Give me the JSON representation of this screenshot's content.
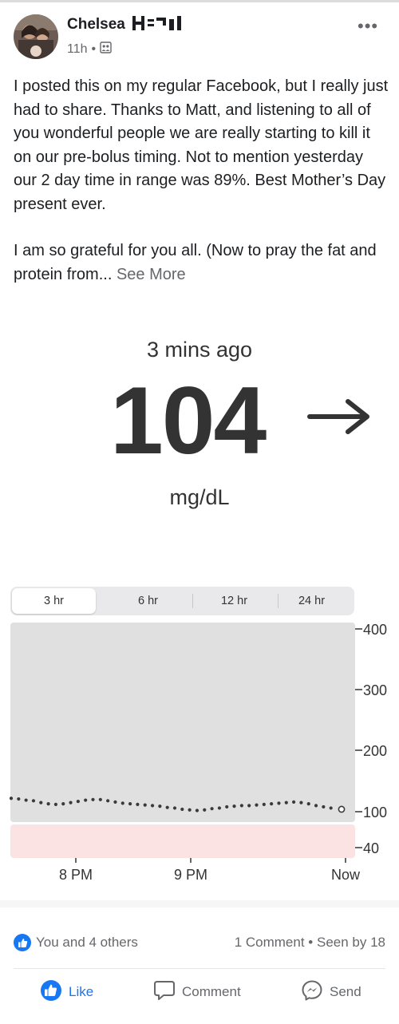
{
  "author": {
    "name": "Chelsea"
  },
  "post_meta": {
    "time": "11h",
    "separator": "•"
  },
  "post": {
    "paragraph1": "I posted this on my regular Facebook, but I really just had to share. Thanks to Matt, and listening to all of you wonderful people we are really starting to kill it on our pre-bolus timing. Not to mention yesterday our 2 day time in range was 89%. Best Mother’s Day present ever.",
    "paragraph2": "I am so grateful for you all. (Now to pray the fat and protein from...",
    "see_more": "See More"
  },
  "cgm": {
    "updated": "3 mins ago",
    "reading": "104",
    "unit": "mg/dL",
    "trend_icon": "arrow-right-icon",
    "ranges": [
      "3 hr",
      "6 hr",
      "12 hr",
      "24 hr"
    ],
    "selected_range": "3 hr"
  },
  "chart_data": {
    "type": "scatter",
    "x_tick_labels": [
      "8 PM",
      "9 PM",
      "Now"
    ],
    "y_ticks": [
      400,
      300,
      200,
      100,
      40
    ],
    "ylim": [
      40,
      400
    ],
    "target_range": [
      70,
      180
    ],
    "low_band": [
      40,
      70
    ],
    "colors": {
      "plot_bg": "#e0e0e0",
      "low_band": "#fbe3e4",
      "points": "#3a3a3a"
    },
    "series": [
      {
        "points": [
          [
            0,
            122
          ],
          [
            1,
            121
          ],
          [
            2,
            119
          ],
          [
            3,
            118
          ],
          [
            4,
            115
          ],
          [
            5,
            113
          ],
          [
            6,
            112
          ],
          [
            7,
            113
          ],
          [
            8,
            115
          ],
          [
            9,
            117
          ],
          [
            10,
            119
          ],
          [
            11,
            120
          ],
          [
            12,
            120
          ],
          [
            13,
            118
          ],
          [
            14,
            116
          ],
          [
            15,
            114
          ],
          [
            16,
            113
          ],
          [
            17,
            112
          ],
          [
            18,
            111
          ],
          [
            19,
            110
          ],
          [
            20,
            109
          ],
          [
            21,
            107
          ],
          [
            22,
            106
          ],
          [
            23,
            104
          ],
          [
            24,
            103
          ],
          [
            25,
            102
          ],
          [
            26,
            103
          ],
          [
            27,
            105
          ],
          [
            28,
            106
          ],
          [
            29,
            108
          ],
          [
            30,
            109
          ],
          [
            31,
            110
          ],
          [
            32,
            110
          ],
          [
            33,
            111
          ],
          [
            34,
            112
          ],
          [
            35,
            113
          ],
          [
            36,
            114
          ],
          [
            37,
            115
          ],
          [
            38,
            116
          ],
          [
            39,
            115
          ],
          [
            40,
            113
          ],
          [
            41,
            110
          ],
          [
            42,
            108
          ],
          [
            43,
            106
          ],
          [
            44,
            104
          ]
        ]
      }
    ]
  },
  "engagement": {
    "reactions": "You and 4 others",
    "comments": "1 Comment",
    "seen": "Seen by 18",
    "separator": "•"
  },
  "actions": {
    "like": "Like",
    "comment": "Comment",
    "send": "Send"
  }
}
